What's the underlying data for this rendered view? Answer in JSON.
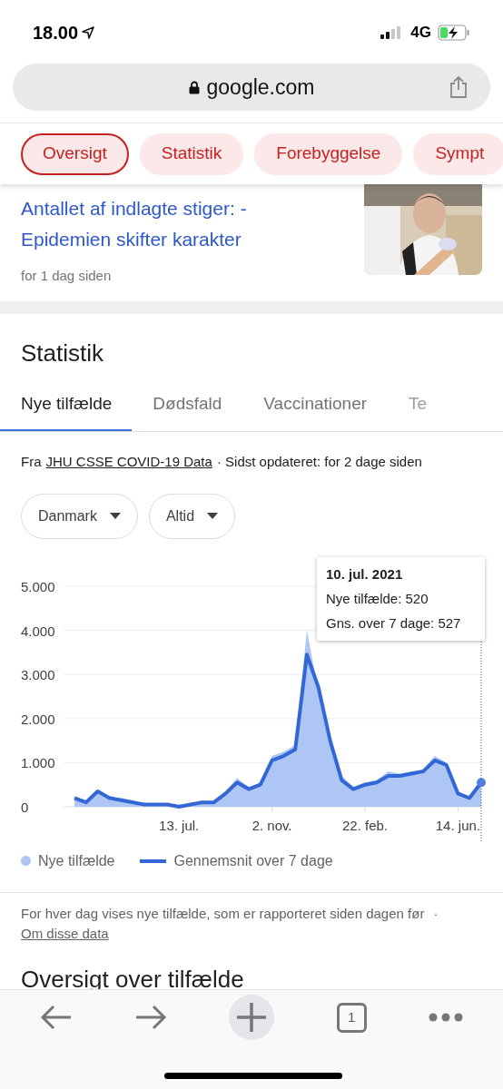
{
  "status_bar": {
    "time": "18.00",
    "network": "4G"
  },
  "address_bar": {
    "url": "google.com"
  },
  "chips": [
    {
      "label": "Oversigt",
      "selected": true
    },
    {
      "label": "Statistik",
      "selected": false
    },
    {
      "label": "Forebyggelse",
      "selected": false
    },
    {
      "label": "Sympt",
      "selected": false
    }
  ],
  "news": {
    "headline": "Antallet af indlagte stiger: - Epidemien skifter karakter",
    "age": "for 1 dag siden"
  },
  "stats": {
    "title": "Statistik",
    "tabs": [
      {
        "label": "Nye tilfælde",
        "selected": true
      },
      {
        "label": "Dødsfald",
        "selected": false
      },
      {
        "label": "Vaccinationer",
        "selected": false
      },
      {
        "label": "Te",
        "selected": false
      }
    ],
    "source": {
      "prefix": "Fra",
      "link": "JHU CSSE COVID-19 Data",
      "suffix": "· Sidst opdateret: for 2 dage siden"
    },
    "filters": [
      {
        "label": "Danmark"
      },
      {
        "label": "Altid"
      }
    ],
    "chart_data": {
      "type": "area",
      "grid": true,
      "ylim": [
        0,
        5
      ],
      "categories": [
        null,
        null,
        null,
        null,
        null,
        null,
        null,
        null,
        null,
        "13. jul.",
        null,
        null,
        null,
        null,
        null,
        null,
        null,
        "2. nov.",
        null,
        null,
        null,
        null,
        null,
        null,
        null,
        "22. feb.",
        null,
        null,
        null,
        null,
        null,
        null,
        null,
        "14. jun.",
        null,
        null
      ],
      "yticks": [
        {
          "value": 0,
          "label": "0"
        },
        {
          "value": 1,
          "label": "1.000"
        },
        {
          "value": 2,
          "label": "2.000"
        },
        {
          "value": 3,
          "label": "3.000"
        },
        {
          "value": 4,
          "label": "4.000"
        },
        {
          "value": 5,
          "label": "5.000"
        }
      ],
      "series": [
        {
          "name": "Nye tilfælde",
          "type": "area",
          "color": "#aec6f4",
          "values": [
            0.2,
            0.1,
            0.35,
            0.2,
            0.2,
            0.15,
            0.05,
            0.05,
            0.05,
            0.05,
            0.05,
            0.15,
            0.1,
            0.35,
            0.65,
            0.45,
            0.55,
            1.15,
            1.25,
            1.4,
            4.0,
            2.6,
            1.6,
            0.7,
            0.45,
            0.55,
            0.6,
            0.8,
            0.75,
            0.8,
            0.85,
            1.15,
            1.0,
            0.35,
            0.2,
            0.5
          ]
        },
        {
          "name": "Gennemsnit over 7 dage",
          "type": "line",
          "color": "#3367d6",
          "values": [
            0.2,
            0.1,
            0.35,
            0.2,
            0.15,
            0.1,
            0.05,
            0.05,
            0.05,
            0.0,
            0.05,
            0.1,
            0.1,
            0.3,
            0.55,
            0.4,
            0.5,
            1.05,
            1.15,
            1.3,
            3.45,
            2.7,
            1.5,
            0.6,
            0.4,
            0.5,
            0.55,
            0.7,
            0.7,
            0.75,
            0.8,
            1.05,
            0.95,
            0.3,
            0.2,
            0.55
          ]
        }
      ]
    },
    "tooltip": {
      "date": "10. jul. 2021",
      "lines": [
        "Nye tilfælde: 520",
        "Gns. over 7 dage: 527"
      ]
    },
    "footnote": {
      "text": "For hver dag vises nye tilfælde, som er rapporteret siden dagen før",
      "separator": "·",
      "link": "Om disse data"
    },
    "next_heading": "Oversigt over tilfælde"
  },
  "toolbar": {
    "tab_count": "1"
  }
}
